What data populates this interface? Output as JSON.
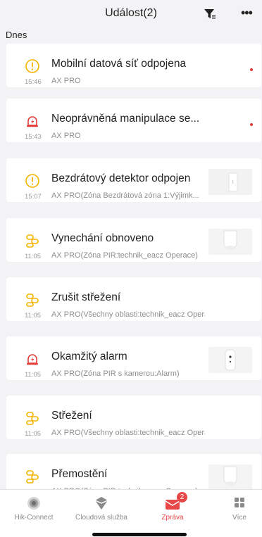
{
  "header": {
    "title": "Událost(2)",
    "filter_icon": "filter-icon",
    "more_icon": "more-icon"
  },
  "section": {
    "label": "Dnes"
  },
  "events": [
    {
      "title": "Mobilní datová síť odpojena",
      "time": "15:46",
      "source": "AX PRO",
      "icon": "warning-icon",
      "unread": true,
      "thumbnail": false
    },
    {
      "title": "Neoprávněná manipulace se...",
      "time": "15:43",
      "source": "AX PRO",
      "icon": "alarm-icon",
      "unread": true,
      "thumbnail": false
    },
    {
      "title": "Bezdrátový detektor odpojen",
      "time": "15:07",
      "source": "AX PRO(Zóna Bezdrátová zóna 1:Výjimk...",
      "icon": "warning-icon",
      "unread": false,
      "thumbnail": true
    },
    {
      "title": "Vynechání obnoveno",
      "time": "11:05",
      "source": "AX PRO(Zóna PIR:technik_eacz Operace)",
      "icon": "users-icon",
      "unread": false,
      "thumbnail": true
    },
    {
      "title": "Zrušit střežení",
      "time": "11:05",
      "source": "AX PRO(Všechny oblasti:technik_eacz Operace)",
      "icon": "users-icon",
      "unread": false,
      "thumbnail": false
    },
    {
      "title": "Okamžitý alarm",
      "time": "11:05",
      "source": "AX PRO(Zóna PIR s kamerou:Alarm)",
      "icon": "alarm-icon",
      "unread": false,
      "thumbnail": true
    },
    {
      "title": "Střežení",
      "time": "11:05",
      "source": "AX PRO(Všechny oblasti:technik_eacz Operace)",
      "icon": "users-icon",
      "unread": false,
      "thumbnail": false
    },
    {
      "title": "Přemostění",
      "time": "11:05",
      "source": "AX PRO(Zóna PIR:technik_eacz Operace)",
      "icon": "users-icon",
      "unread": false,
      "thumbnail": true
    }
  ],
  "tabs": [
    {
      "label": "Hik-Connect",
      "icon": "hik-connect-icon",
      "active": false
    },
    {
      "label": "Cloudová služba",
      "icon": "cloud-service-icon",
      "active": false
    },
    {
      "label": "Zpráva",
      "icon": "message-icon",
      "active": true,
      "badge": "2"
    },
    {
      "label": "Více",
      "icon": "more-grid-icon",
      "active": false
    }
  ],
  "colors": {
    "accent": "#e8474a",
    "warning": "#f5b400",
    "alarm": "#e53935",
    "background": "#f3f3f5"
  }
}
